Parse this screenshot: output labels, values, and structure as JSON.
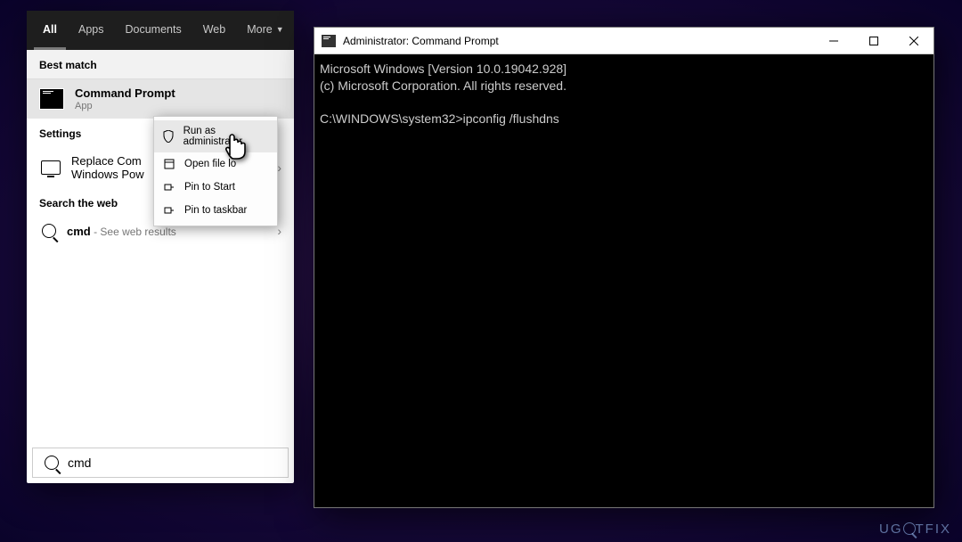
{
  "search_panel": {
    "tabs": {
      "all": "All",
      "apps": "Apps",
      "documents": "Documents",
      "web": "Web",
      "more": "More"
    },
    "sections": {
      "best_match": "Best match",
      "settings": "Settings",
      "search_web": "Search the web"
    },
    "best_match_item": {
      "title": "Command Prompt",
      "subtitle": "App"
    },
    "settings_item": {
      "line1": "Replace Com",
      "line2": "Windows Pow"
    },
    "web_item": {
      "query": "cmd",
      "hint": " - See web results"
    },
    "search_value": "cmd"
  },
  "context_menu": {
    "run_admin": "Run as administrator",
    "open_loc": "Open file lo",
    "pin_start": "Pin to Start",
    "pin_taskbar": "Pin to taskbar"
  },
  "cmd": {
    "title": "Administrator: Command Prompt",
    "line1": "Microsoft Windows [Version 10.0.19042.928]",
    "line2": "(c) Microsoft Corporation. All rights reserved.",
    "blank": "",
    "prompt": "C:\\WINDOWS\\system32>ipconfig /flushdns"
  },
  "watermark": {
    "part1": "UG",
    "part2": "TFIX"
  }
}
